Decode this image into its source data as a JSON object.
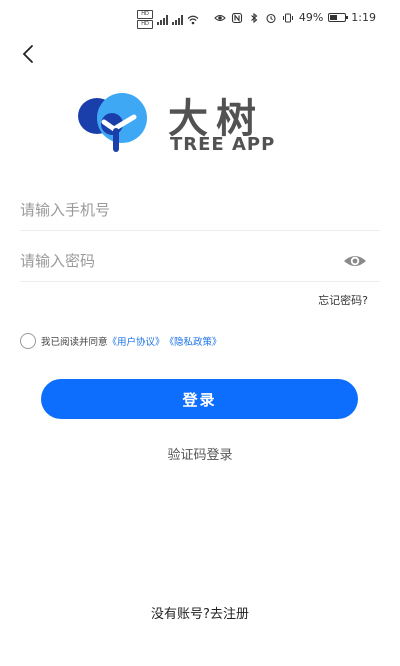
{
  "status_bar": {
    "battery_text": "49%",
    "time": "1:19",
    "battery_level": 0.49,
    "left_icons": [
      "sim-hd-icon",
      "signal-4g-icon",
      "signal-5g-icon",
      "wifi-icon"
    ],
    "right_icons": [
      "eye-comfort-icon",
      "nfc-icon",
      "bluetooth-icon",
      "alarm-icon",
      "vibrate-icon"
    ]
  },
  "header": {
    "back_icon": "chevron-left-icon"
  },
  "logo": {
    "name_cn": "大树",
    "name_en": "TREE APP",
    "colors": {
      "dark_blue": "#1a3faa",
      "light_blue": "#3ea8f5",
      "text_gray": "#525252"
    }
  },
  "form": {
    "phone_placeholder": "请输入手机号",
    "phone_value": "",
    "password_placeholder": "请输入密码",
    "password_value": "",
    "eye_icon": "eye-icon",
    "forgot_password": "忘记密码?"
  },
  "agreement": {
    "text": "我已阅读并同意",
    "user_agreement": "《用户协议》",
    "privacy_policy": "《隐私政策》",
    "checked": false
  },
  "actions": {
    "login_label": "登录",
    "login_color": "#0d6efd",
    "sms_login_label": "验证码登录",
    "register_label": "没有账号?去注册"
  }
}
